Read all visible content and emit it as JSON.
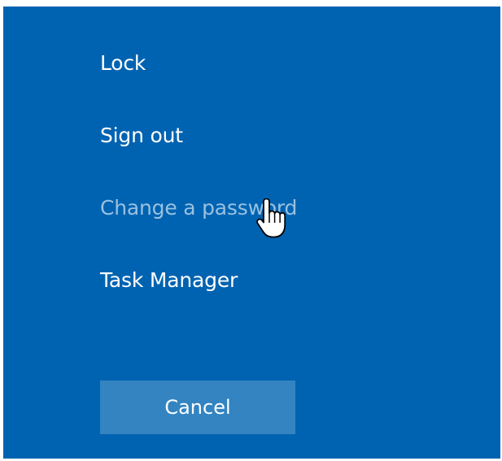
{
  "options": {
    "lock_label": "Lock",
    "sign_out_label": "Sign out",
    "change_password_label": "Change a password",
    "task_manager_label": "Task Manager"
  },
  "cancel_label": "Cancel",
  "hovered_option": "Change a password",
  "cursor_icon": "hand-pointer-icon",
  "colors": {
    "background": "#0063b1",
    "text": "#ffffff",
    "hover_text": "#99c1e0",
    "button": "#3384c1"
  }
}
